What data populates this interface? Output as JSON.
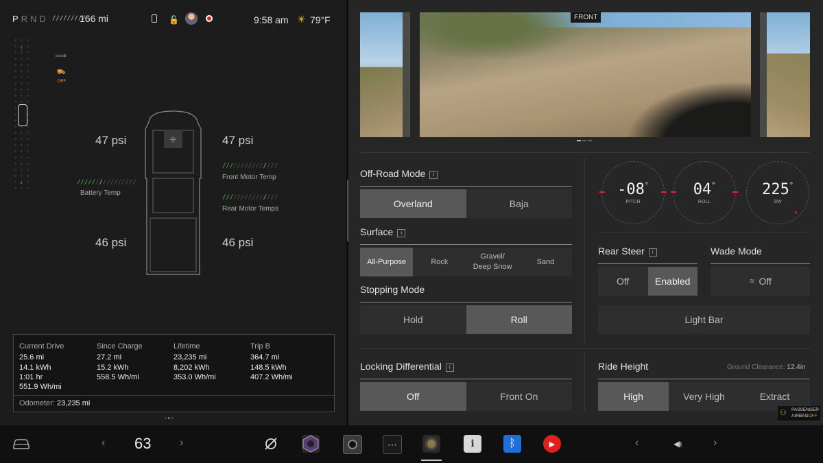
{
  "status": {
    "gears": [
      "P",
      "R",
      "N",
      "D"
    ],
    "active_gear": "P",
    "range": "166 mi",
    "time": "9:58 am",
    "temperature": "79°F"
  },
  "vehicle": {
    "tires": {
      "front_left": "47 psi",
      "front_right": "47 psi",
      "rear_left": "46 psi",
      "rear_right": "46 psi"
    },
    "battery_temp_label": "Battery Temp",
    "front_motor_label": "Front Motor Temp",
    "rear_motor_label": "Rear Motor Temps",
    "traction_off_label": "OFF"
  },
  "stats": {
    "columns": [
      {
        "header": "Current Drive",
        "lines": [
          "25.6 mi",
          "14.1 kWh",
          "1:01 hr",
          "551.9 Wh/mi"
        ]
      },
      {
        "header": "Since Charge",
        "lines": [
          "27.2 mi",
          "15.2 kWh",
          "558.5 Wh/mi"
        ]
      },
      {
        "header": "Lifetime",
        "lines": [
          "23,235 mi",
          "8,202 kWh",
          "353.0 Wh/mi"
        ]
      },
      {
        "header": "Trip B",
        "lines": [
          "364.7 mi",
          "148.5 kWh",
          "407.2 Wh/mi"
        ]
      }
    ],
    "odometer_label": "Odometer:",
    "odometer_value": "23,235 mi"
  },
  "camera": {
    "label": "FRONT"
  },
  "offroad": {
    "title": "Off-Road Mode",
    "options": [
      "Overland",
      "Baja"
    ],
    "selected": "Overland"
  },
  "surface": {
    "title": "Surface",
    "options": [
      "All-Purpose",
      "Rock",
      "Gravel/\nDeep Snow",
      "Sand"
    ],
    "selected": "All-Purpose"
  },
  "stopping": {
    "title": "Stopping Mode",
    "options": [
      "Hold",
      "Roll"
    ],
    "selected": "Roll"
  },
  "locking": {
    "title": "Locking Differential",
    "options": [
      "Off",
      "Front On"
    ],
    "selected": "Off"
  },
  "gauges": [
    {
      "value": "-08",
      "unit": "°",
      "label": "PITCH"
    },
    {
      "value": "04",
      "unit": "°",
      "label": "ROLL"
    },
    {
      "value": "225",
      "unit": "°",
      "label": "SW"
    }
  ],
  "rear_steer": {
    "title": "Rear Steer",
    "options": [
      "Off",
      "Enabled"
    ],
    "selected": "Enabled"
  },
  "wade": {
    "title": "Wade Mode",
    "button": "Off"
  },
  "light_bar": {
    "label": "Light Bar"
  },
  "ride_height": {
    "title": "Ride Height",
    "clearance_label": "Ground Clearance:",
    "clearance_value": "12.4in",
    "options": [
      "High",
      "Very High",
      "Extract"
    ],
    "selected": "High"
  },
  "airbag": {
    "line1": "PASSENGER",
    "line2a": "AIRBAG",
    "line2b": "OFF"
  },
  "bottom": {
    "temp_setpoint": "63"
  },
  "colors": {
    "accent_red": "#e02020",
    "accent_green": "#4fbf4f",
    "accent_orange": "#e0a030",
    "bluetooth": "#1e6fd8"
  }
}
